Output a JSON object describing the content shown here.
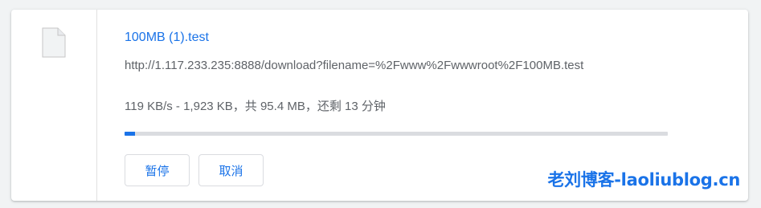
{
  "download": {
    "filename": "100MB (1).test",
    "url": "http://1.117.233.235:8888/download?filename=%2Fwww%2Fwwwroot%2F100MB.test",
    "status": "119 KB/s - 1,923 KB，共 95.4 MB，还剩 13 分钟",
    "progress_fraction": 0.0197,
    "icon": "file-icon",
    "pause_label": "暂停",
    "cancel_label": "取消"
  },
  "watermark": {
    "text": "老刘博客-laoliublog.cn"
  },
  "colors": {
    "accent": "#1a73e8",
    "track": "#dadce0",
    "text_secondary": "#5f6368",
    "background": "#f1f3f4"
  }
}
